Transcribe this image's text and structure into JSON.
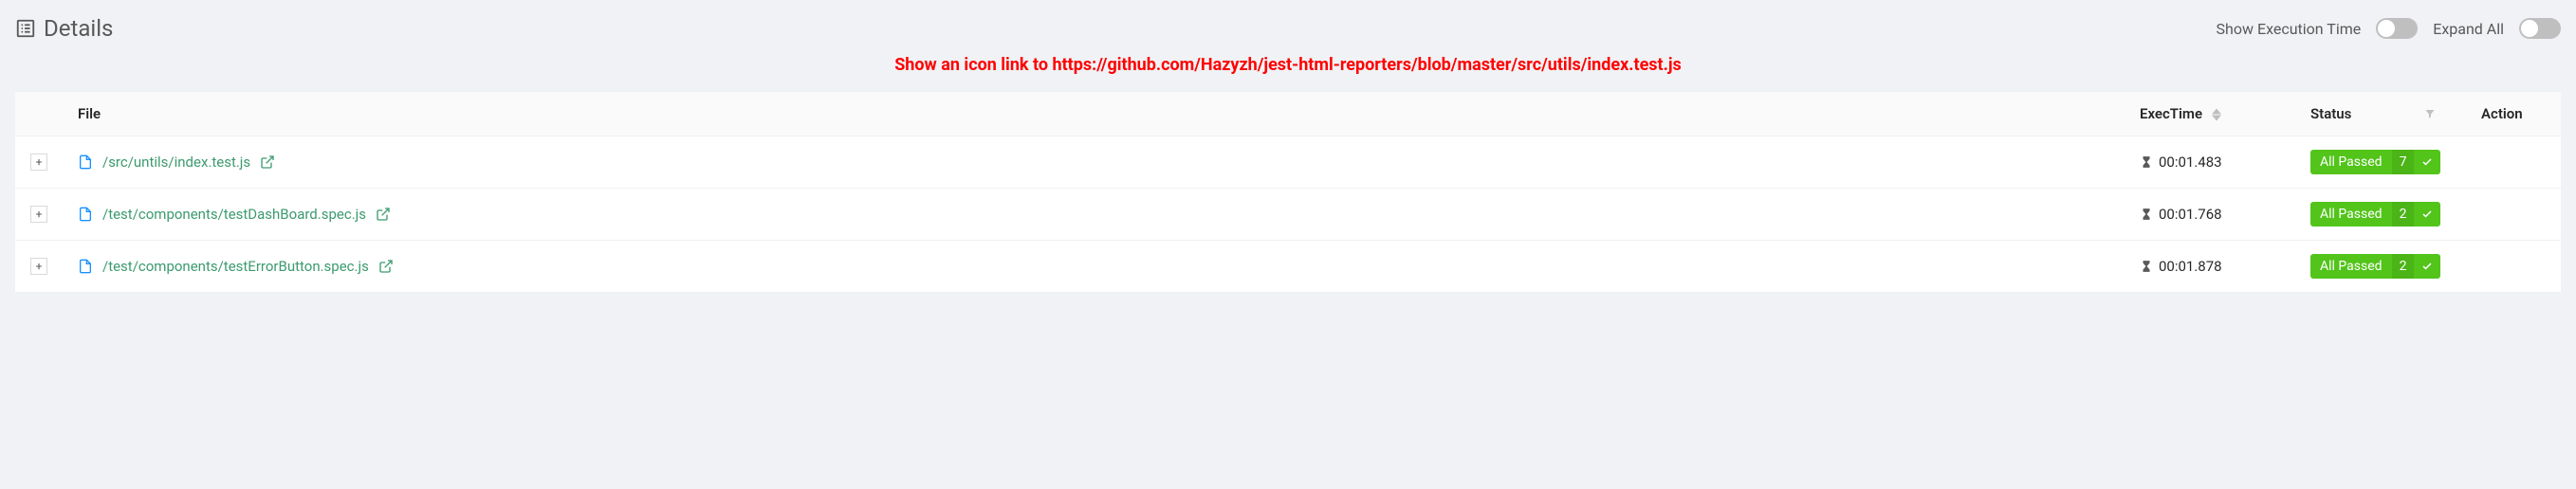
{
  "header": {
    "title": "Details",
    "toggles": {
      "showExecTime": "Show Execution Time",
      "expandAll": "Expand All"
    }
  },
  "annotation": "Show an icon link to https://github.com/Hazyzh/jest-html-reporters/blob/master/src/utils/index.test.js",
  "columns": {
    "file": "File",
    "execTime": "ExecTime",
    "status": "Status",
    "action": "Action"
  },
  "rows": [
    {
      "path": "/src/untils/index.test.js",
      "execTime": "00:01.483",
      "statusLabel": "All Passed",
      "statusCount": "7"
    },
    {
      "path": "/test/components/testDashBoard.spec.js",
      "execTime": "00:01.768",
      "statusLabel": "All Passed",
      "statusCount": "2"
    },
    {
      "path": "/test/components/testErrorButton.spec.js",
      "execTime": "00:01.878",
      "statusLabel": "All Passed",
      "statusCount": "2"
    }
  ]
}
